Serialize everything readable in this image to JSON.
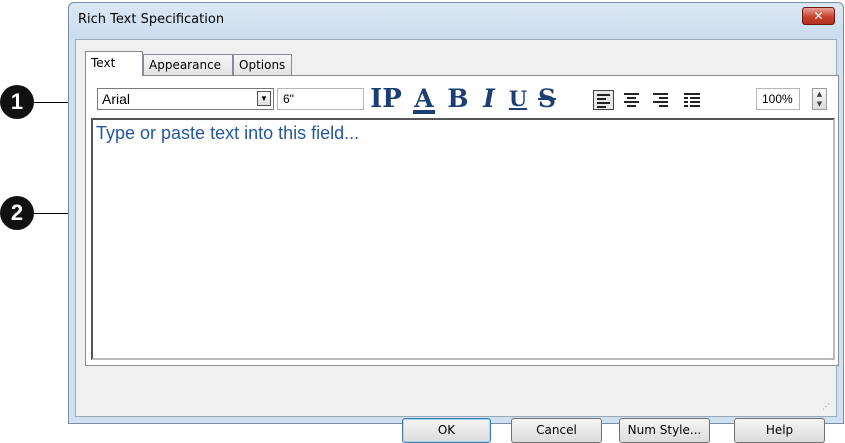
{
  "callouts": [
    "1",
    "2"
  ],
  "window": {
    "title": "Rich Text Specification",
    "close_glyph": "✕"
  },
  "tabs": [
    {
      "label": "Text",
      "active": true
    },
    {
      "label": "Appearance",
      "active": false
    },
    {
      "label": "Options",
      "active": false
    }
  ],
  "toolbar": {
    "font_value": "Arial",
    "size_value": "6\"",
    "paragraph_icon": "IP",
    "text_color_icon": "A",
    "bold_icon": "B",
    "italic_icon": "I",
    "underline_icon": "U",
    "strikethrough_icon": "S",
    "zoom_value": "100%",
    "accent_color": "#1b3f73"
  },
  "editor": {
    "placeholder": "Type or paste text into this field..."
  },
  "buttons": {
    "ok": "OK",
    "cancel": "Cancel",
    "num_style": "Num Style...",
    "help": "Help"
  }
}
